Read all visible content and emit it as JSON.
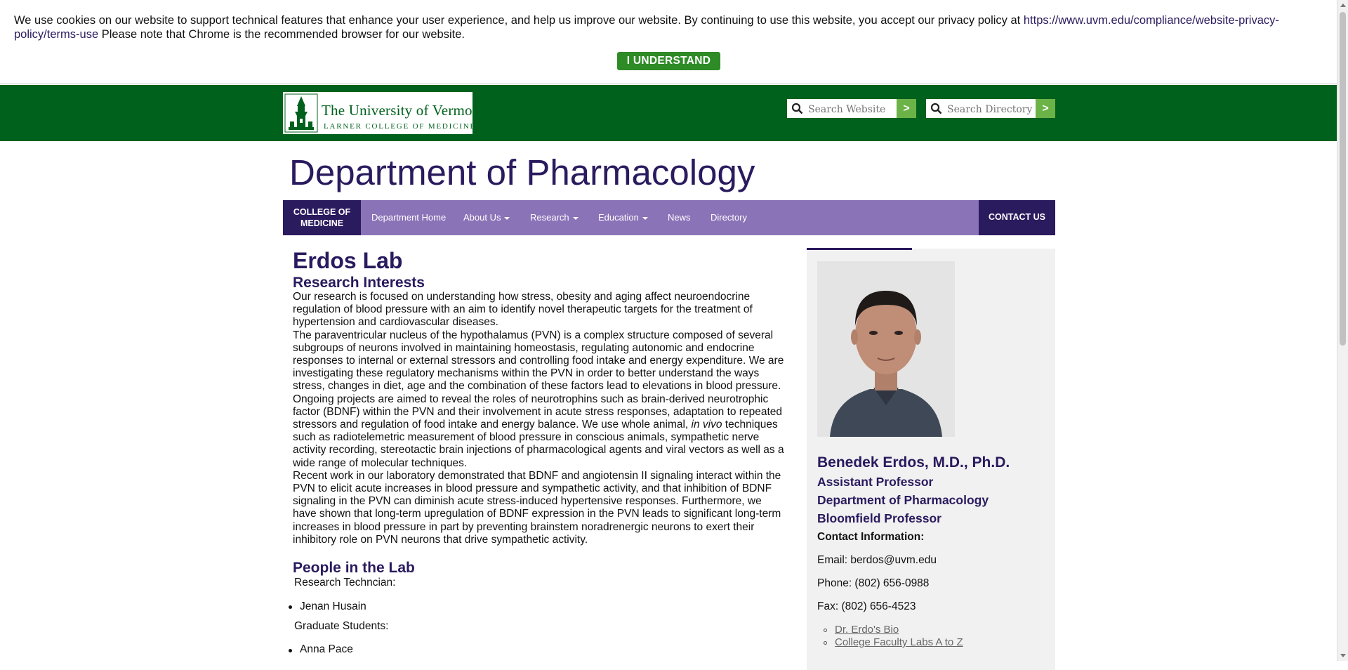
{
  "cookie": {
    "text": "We use cookies on our website to support technical features that enhance your user experience, and help us improve our website. By continuing to use this website, you accept our privacy policy at ",
    "link": "https://www.uvm.edu/compliance/website-privacy-policy/terms-use",
    "text2": " Please note that Chrome is the recommended browser for our website.",
    "button": "I UNDERSTAND"
  },
  "header": {
    "logo_name": "The University of Vermont",
    "logo_sub": "LARNER COLLEGE OF MEDICINE",
    "search_website_placeholder": "Search Website",
    "search_directory_placeholder": "Search Directory",
    "go_label": ">"
  },
  "dept_title": "Department of Pharmacology",
  "nav": {
    "college": "COLLEGE OF MEDICINE",
    "items": [
      "Department Home",
      "About Us",
      "Research",
      "Education",
      "News",
      "Directory"
    ],
    "contact": "CONTACT US"
  },
  "main": {
    "lab_title": "Erdos Lab",
    "research_heading": "Research Interests",
    "p1": "Our research is focused on understanding how stress, obesity and aging affect neuroendocrine regulation of blood pressure with an aim to identify novel therapeutic targets for the treatment of hypertension and cardiovascular diseases.",
    "p2a": "The paraventricular nucleus of the hypothalamus (PVN) is a complex structure composed of several subgroups of neurons involved in maintaining homeostasis, regulating autonomic and endocrine responses to internal or external stressors and controlling food intake and energy expenditure. We are investigating these regulatory mechanisms within the PVN in order to better understand the ways stress, changes in diet, age and the combination of these factors lead to elevations in blood pressure. Ongoing projects are aimed to reveal the roles of neurotrophins such as brain-derived neurotrophic factor (BDNF) within the PVN and their involvement in acute stress  responses, adaptation to repeated stressors and regulation of food intake and energy balance.  We use whole animal, ",
    "p2_italic": "in vivo",
    "p2b": " techniques such as radiotelemetric measurement of blood pressure in conscious animals, sympathetic nerve activity recording, stereotactic brain injections of pharmacological agents and viral vectors as well as a wide range of molecular techniques.",
    "p3": "Recent work in our laboratory demonstrated that BDNF and angiotensin II signaling interact within the PVN to elicit acute increases in blood pressure and sympathetic activity, and that inhibition of BDNF signaling in the PVN can diminish acute stress-induced hypertensive responses.  Furthermore, we have shown that long-term upregulation of BDNF expression in the PVN leads to significant long-term increases in blood pressure in part by preventing brainstem noradrenergic neurons to exert their inhibitory role on PVN neurons that drive sympathetic activity.",
    "people_heading": "People in the Lab",
    "tech_label": "Research Techncian:",
    "tech_name": "Jenan Husain",
    "grad_label": "Graduate Students:",
    "grad_name": "Anna Pace"
  },
  "sidebar": {
    "name": "Benedek Erdos, M.D., Ph.D.",
    "title1": "Assistant Professor",
    "title2": "Department of Pharmacology",
    "title3": "Bloomfield Professor",
    "contact_heading": "Contact Information:",
    "email": "Email:  berdos@uvm.edu",
    "phone": "Phone:  (802) 656-0988",
    "fax": "Fax:  (802) 656-4523",
    "link1": "Dr. Erdo's Bio",
    "link2": "College Faculty Labs A to Z"
  },
  "colors": {
    "uvm_green": "#00611c",
    "purple_dark": "#2a1a5e",
    "purple_nav": "#8b73b8",
    "button_green": "#2e8b26"
  }
}
